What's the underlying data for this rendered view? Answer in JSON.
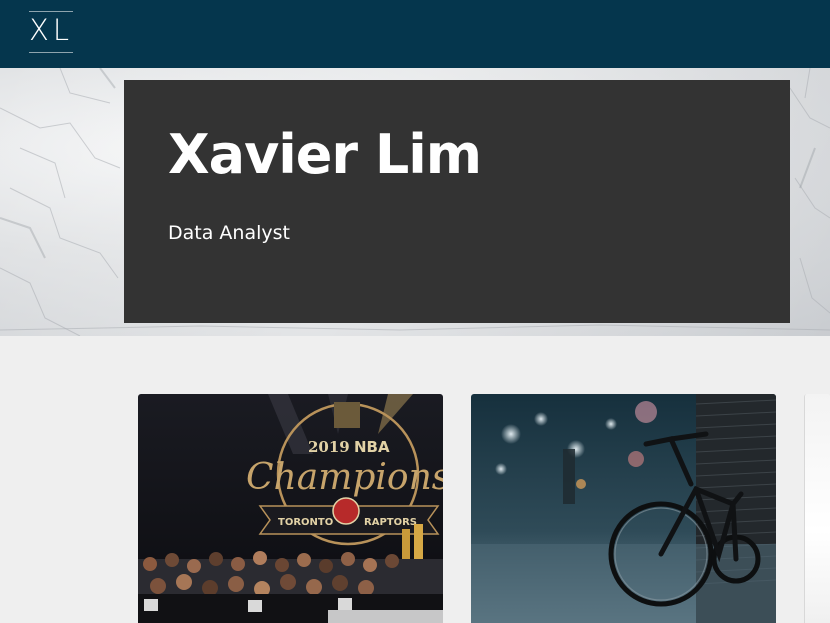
{
  "nav": {
    "logo_text": "XL"
  },
  "hero": {
    "name": "Xavier Lim",
    "role": "Data Analyst"
  },
  "cards": [
    {
      "image_desc_icon": "nba-champions-photo",
      "banner": {
        "year": "2019",
        "league": "NBA",
        "title": "Champions",
        "left_word": "TORONTO",
        "right_word": "RAPTORS"
      }
    },
    {
      "image_desc_icon": "bicycle-street-photo"
    },
    {
      "image_desc_icon": "partial-card-photo"
    }
  ],
  "colors": {
    "topbar": "#05364d",
    "hero_card": "#333333",
    "page_bg": "#efefef"
  }
}
